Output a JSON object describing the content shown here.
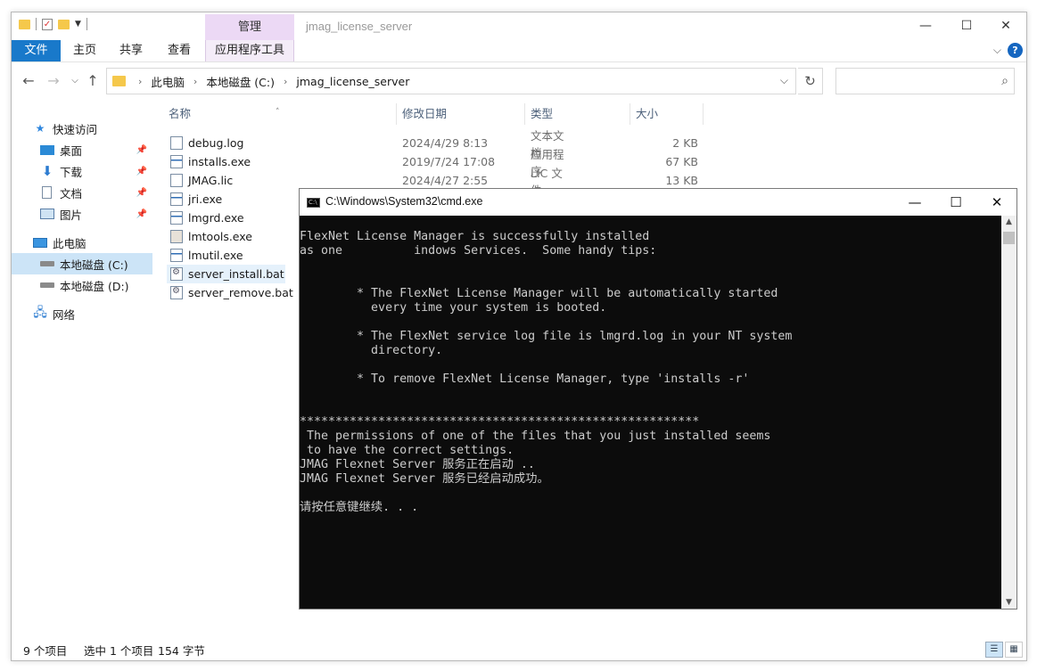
{
  "explorer": {
    "title": "jmag_license_server",
    "manage_tab": "管理",
    "window_controls": {
      "minimize": "—",
      "maximize": "☐",
      "close": "✕"
    },
    "ribbon_tabs": [
      "文件",
      "主页",
      "共享",
      "查看",
      "应用程序工具"
    ],
    "address": {
      "crumbs": [
        "此电脑",
        "本地磁盘 (C:)",
        "jmag_license_server"
      ]
    },
    "search": {
      "placeholder": ""
    },
    "sidebar": [
      {
        "label": "快速访问",
        "icon": "star-icon"
      },
      {
        "label": "桌面",
        "icon": "desktop-icon",
        "pinned": true
      },
      {
        "label": "下载",
        "icon": "download-icon",
        "pinned": true
      },
      {
        "label": "文档",
        "icon": "document-icon",
        "pinned": true
      },
      {
        "label": "图片",
        "icon": "picture-icon",
        "pinned": true
      },
      {
        "label": "此电脑",
        "icon": "computer-icon"
      },
      {
        "label": "本地磁盘 (C:)",
        "icon": "drive-icon",
        "selected": true
      },
      {
        "label": "本地磁盘 (D:)",
        "icon": "drive-icon"
      },
      {
        "label": "网络",
        "icon": "network-icon"
      }
    ],
    "columns": [
      "名称",
      "修改日期",
      "类型",
      "大小"
    ],
    "files": [
      {
        "name": "debug.log",
        "date": "2024/4/29 8:13",
        "type": "文本文档",
        "size": "2 KB",
        "kind": "txt"
      },
      {
        "name": "installs.exe",
        "date": "2019/7/24 17:08",
        "type": "应用程序",
        "size": "67 KB",
        "kind": "exe"
      },
      {
        "name": "JMAG.lic",
        "date": "2024/4/27 2:55",
        "type": "LIC 文件",
        "size": "13 KB",
        "kind": "txt"
      },
      {
        "name": "jri.exe",
        "kind": "exe"
      },
      {
        "name": "lmgrd.exe",
        "kind": "exe"
      },
      {
        "name": "lmtools.exe",
        "kind": "tool"
      },
      {
        "name": "lmutil.exe",
        "kind": "exe"
      },
      {
        "name": "server_install.bat",
        "kind": "bat",
        "selected": true
      },
      {
        "name": "server_remove.bat",
        "kind": "bat"
      }
    ],
    "status": {
      "count": "9 个项目",
      "selection": "选中 1 个项目",
      "size": "154 字节"
    }
  },
  "cmd": {
    "title": "C:\\Windows\\System32\\cmd.exe",
    "window_controls": {
      "minimize": "—",
      "maximize": "☐",
      "close": "✕"
    },
    "output": "FlexNet License Manager is successfully installed\nas one          indows Services.  Some handy tips:\n\n\n        * The FlexNet License Manager will be automatically started\n          every time your system is booted.\n\n        * The FlexNet service log file is lmgrd.log in your NT system\n          directory.\n\n        * To remove FlexNet License Manager, type 'installs -r'\n\n\n********************************************************\n The permissions of one of the files that you just installed seems\n to have the correct settings.\nJMAG Flexnet Server 服务正在启动 ..\nJMAG Flexnet Server 服务已经启动成功。\n\n请按任意键继续. . ."
  }
}
